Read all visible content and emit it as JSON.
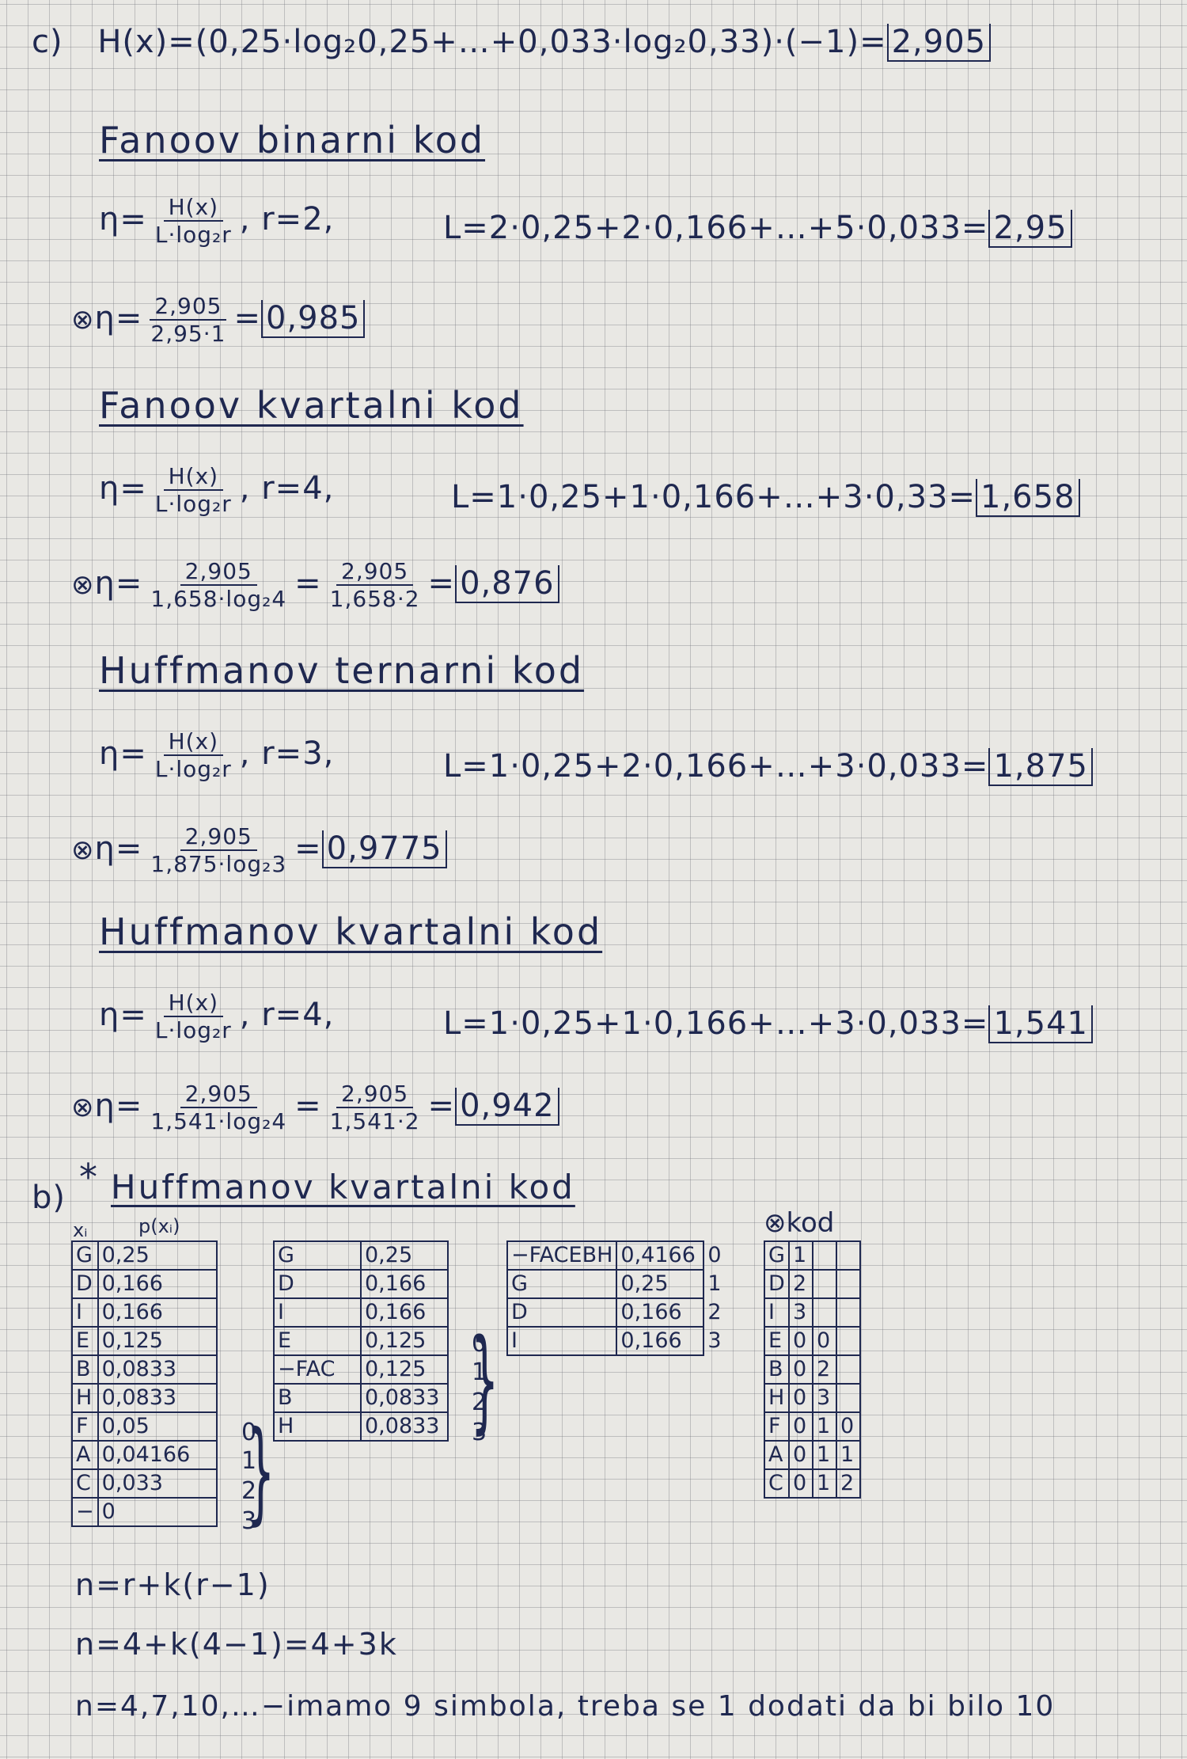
{
  "section_c": {
    "label": "c)",
    "entropy": "H(x)=(0,25·log₂0,25+…+0,033·log₂0,33)·(−1)=",
    "entropy_result": "2,905",
    "blocks": [
      {
        "heading": "Fanoov binarni kod",
        "eta_num": "H(x)",
        "eta_den": "L·log₂r",
        "r": ", r=2,",
        "L": "L=2·0,25+2·0,166+…+5·0,033=",
        "L_result": "2,95",
        "calc_num": "2,905",
        "calc_den": "2,95·1",
        "calc_extra_num": "",
        "calc_extra_den": "",
        "calc_result": "0,985"
      },
      {
        "heading": "Fanoov kvartalni kod",
        "eta_num": "H(x)",
        "eta_den": "L·log₂r",
        "r": ", r=4,",
        "L": "L=1·0,25+1·0,166+…+3·0,33=",
        "L_result": "1,658",
        "calc_num": "2,905",
        "calc_den": "1,658·log₂4",
        "calc_extra_num": "2,905",
        "calc_extra_den": "1,658·2",
        "calc_result": "0,876"
      },
      {
        "heading": "Huffmanov ternarni kod",
        "eta_num": "H(x)",
        "eta_den": "L·log₂r",
        "r": ", r=3,",
        "L": "L=1·0,25+2·0,166+…+3·0,033=",
        "L_result": "1,875",
        "calc_num": "2,905",
        "calc_den": "1,875·log₂3",
        "calc_extra_num": "",
        "calc_extra_den": "",
        "calc_result": "0,9775"
      },
      {
        "heading": "Huffmanov kvartalni kod",
        "eta_num": "H(x)",
        "eta_den": "L·log₂r",
        "r": ", r=4,",
        "L": "L=1·0,25+1·0,166+…+3·0,033=",
        "L_result": "1,541",
        "calc_num": "2,905",
        "calc_den": "1,541·log₂4",
        "calc_extra_num": "2,905",
        "calc_extra_den": "1,541·2",
        "calc_result": "0,942"
      }
    ]
  },
  "section_b": {
    "label": "b)",
    "star": "*",
    "heading": "Huffmanov kvartalni kod",
    "col_x": "xᵢ",
    "col_p": "p(xᵢ)",
    "table1": [
      [
        "G",
        "0,25"
      ],
      [
        "D",
        "0,166"
      ],
      [
        "I",
        "0,166"
      ],
      [
        "E",
        "0,125"
      ],
      [
        "B",
        "0,0833"
      ],
      [
        "H",
        "0,0833"
      ],
      [
        "F",
        "0,05"
      ],
      [
        "A",
        "0,04166"
      ],
      [
        "C",
        "0,033"
      ],
      [
        "−",
        "0"
      ]
    ],
    "table1_indices": [
      "0",
      "1",
      "2",
      "3"
    ],
    "table2": [
      [
        "G",
        "0,25"
      ],
      [
        "D",
        "0,166"
      ],
      [
        "I",
        "0,166"
      ],
      [
        "E",
        "0,125"
      ],
      [
        "−FAC",
        "0,125"
      ],
      [
        "B",
        "0,0833"
      ],
      [
        "H",
        "0,0833"
      ]
    ],
    "table2_indices": [
      "0",
      "1",
      "2",
      "3"
    ],
    "table3": [
      [
        "−FACEBH",
        "0,4166",
        "0"
      ],
      [
        "G",
        "0,25",
        "1"
      ],
      [
        "D",
        "0,166",
        "2"
      ],
      [
        "I",
        "0,166",
        "3"
      ]
    ],
    "code_title": "kod",
    "code_table": [
      [
        "G",
        "1",
        "",
        ""
      ],
      [
        "D",
        "2",
        "",
        ""
      ],
      [
        "I",
        "3",
        "",
        ""
      ],
      [
        "E",
        "0",
        "0",
        ""
      ],
      [
        "B",
        "0",
        "2",
        ""
      ],
      [
        "H",
        "0",
        "3",
        ""
      ],
      [
        "F",
        "0",
        "1",
        "0"
      ],
      [
        "A",
        "0",
        "1",
        "1"
      ],
      [
        "C",
        "0",
        "1",
        "2"
      ]
    ],
    "formula1": "n=r+k(r−1)",
    "formula2": "n=4+k(4−1)=4+3k",
    "formula3": "n=4,7,10,…−imamo 9 simbola, treba se 1 dodati da bi bilo 10"
  }
}
